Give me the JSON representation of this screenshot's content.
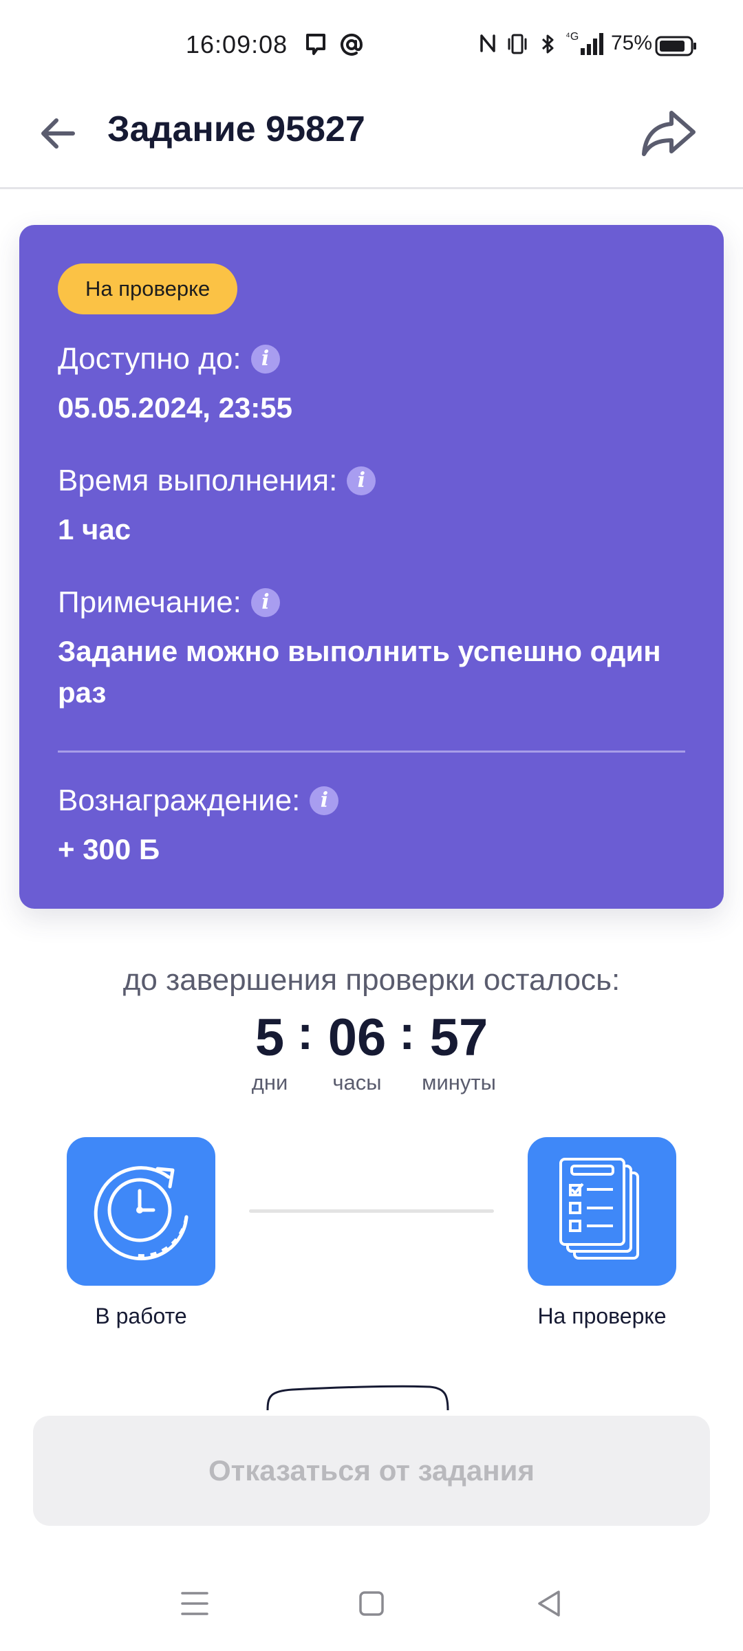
{
  "status_bar": {
    "time": "16:09:08",
    "battery": "75%",
    "icons": [
      "message-icon",
      "at-icon",
      "nfc-icon",
      "vibrate-icon",
      "bluetooth-icon",
      "signal-4g-icon",
      "battery-icon"
    ]
  },
  "header": {
    "title": "Задание 95827",
    "back_icon": "arrow-left-icon",
    "share_icon": "share-icon"
  },
  "card": {
    "status_badge": "На проверке",
    "available_label": "Доступно до:",
    "available_value": "05.05.2024, 23:55",
    "duration_label": "Время выполнения:",
    "duration_value": "1 час",
    "note_label": "Примечание:",
    "note_value": "Задание можно выполнить успешно один раз",
    "reward_label": "Вознаграждение:",
    "reward_value": "+ 300 Б",
    "info_glyph": "i",
    "colors": {
      "card_bg": "#6b5dd3",
      "badge_bg": "#fbc245"
    }
  },
  "countdown": {
    "caption": "до завершения проверки осталось:",
    "days": "5",
    "hours": "06",
    "minutes": "57",
    "separator": ":",
    "days_label": "дни",
    "hours_label": "часы",
    "minutes_label": "минуты"
  },
  "steps": [
    {
      "label": "В работе",
      "icon": "clock-refresh-icon"
    },
    {
      "label": "На проверке",
      "icon": "checklist-document-icon"
    }
  ],
  "actions": {
    "refuse_label": "Отказаться от задания"
  },
  "nav_bar": {
    "icons": [
      "menu-icon",
      "home-square-icon",
      "back-triangle-icon"
    ]
  },
  "colors": {
    "accent_blue": "#3f88f8",
    "text_dark": "#161a33"
  }
}
